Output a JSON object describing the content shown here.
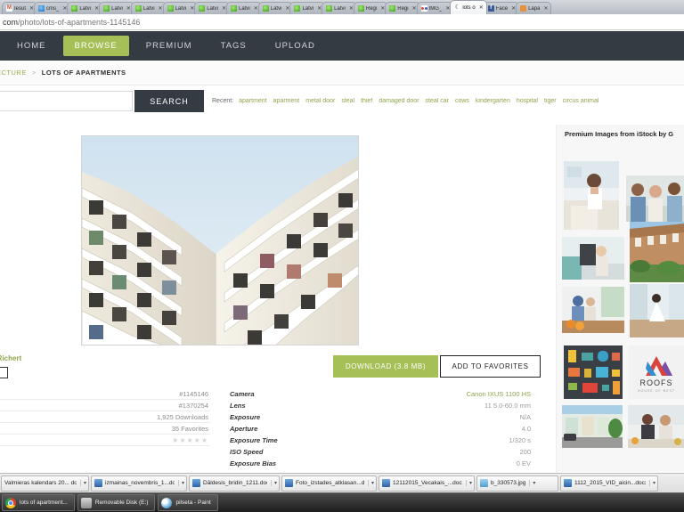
{
  "browser": {
    "tabs": [
      {
        "label": "Iesūt",
        "favicon": "gmail-icon",
        "active": false
      },
      {
        "label": "cms_",
        "favicon": "blue-globe-icon",
        "active": false
      },
      {
        "label": "Latvi",
        "favicon": "green-globe-icon",
        "active": false
      },
      {
        "label": "Latvi",
        "favicon": "green-globe-icon",
        "active": false
      },
      {
        "label": "Latvi",
        "favicon": "green-globe-icon",
        "active": false
      },
      {
        "label": "Latvi",
        "favicon": "green-globe-icon",
        "active": false
      },
      {
        "label": "Latvi",
        "favicon": "green-globe-icon",
        "active": false
      },
      {
        "label": "Latvi",
        "favicon": "green-globe-icon",
        "active": false
      },
      {
        "label": "Latvi",
        "favicon": "green-globe-icon",
        "active": false
      },
      {
        "label": "Latvi",
        "favicon": "green-globe-icon",
        "active": false
      },
      {
        "label": "Latvi",
        "favicon": "green-globe-icon",
        "active": false
      },
      {
        "label": "Reģi",
        "favicon": "green-globe-icon",
        "active": false
      },
      {
        "label": "Reģi",
        "favicon": "green-globe-icon",
        "active": false
      },
      {
        "label": "IMG_",
        "favicon": "dots-icon",
        "active": false
      },
      {
        "label": "lots o",
        "favicon": "moon-icon",
        "active": true
      },
      {
        "label": "Face",
        "favicon": "facebook-icon",
        "active": false
      },
      {
        "label": "Lapa",
        "favicon": "orange-icon",
        "active": false
      }
    ],
    "close_glyph": "✕",
    "url_domain": "com",
    "url_path": "/photo/lots-of-apartments-1145146"
  },
  "site": {
    "nav": [
      {
        "label": "HOME",
        "active": false
      },
      {
        "label": "BROWSE",
        "active": true
      },
      {
        "label": "PREMIUM",
        "active": false
      },
      {
        "label": "TAGS",
        "active": false
      },
      {
        "label": "UPLOAD",
        "active": false
      }
    ],
    "breadcrumb": {
      "previous": "ECTURE",
      "separator": ">",
      "current": "LOTS OF APARTMENTS"
    },
    "search": {
      "value": "",
      "placeholder": "",
      "button_label": "SEARCH",
      "recent_label": "Recent:",
      "recent_tags": [
        "apartment",
        "aparment",
        "metal door",
        "steal",
        "thief",
        "damaged door",
        "steal car",
        "cows",
        "kindergarten",
        "hospital",
        "tiger",
        "circus animal"
      ]
    },
    "photo": {
      "alt": "lots of apartments - modern apartment building facade with zigzag balconies"
    },
    "author": {
      "name": "a Richert"
    },
    "actions": {
      "download_label": "DOWNLOAD (3.8 MB)",
      "favorites_label": "ADD TO FAVORITES"
    },
    "stats": [
      {
        "value": "#1145146"
      },
      {
        "value": "#1370254"
      },
      {
        "value": "1,925 Downloads"
      },
      {
        "value": "35 Favorites"
      },
      {
        "value": "★★★★★"
      }
    ],
    "exif": [
      {
        "key": "Camera",
        "value": "Canon IXUS 1100 HS"
      },
      {
        "key": "Lens",
        "value": "11 5.0-60.0 mm"
      },
      {
        "key": "Exposure",
        "value": "N/A"
      },
      {
        "key": "Aperture",
        "value": "4.0"
      },
      {
        "key": "Exposure Time",
        "value": "1/320 s"
      },
      {
        "key": "ISO Speed",
        "value": "200"
      },
      {
        "key": "Exposure Bias",
        "value": "0 EV"
      }
    ],
    "sidebar": {
      "title": "Premium Images from iStock by G",
      "thumbnails": [
        {
          "name": "woman-in-kitchen"
        },
        {
          "name": "family-group-outdoor"
        },
        {
          "name": "woman-on-terrace"
        },
        {
          "name": "townhouses-street"
        },
        {
          "name": "family-breakfast"
        },
        {
          "name": "woman-on-deck"
        },
        {
          "name": "furniture-icons-set"
        },
        {
          "name": "roofs-logo",
          "caption": "ROOFS",
          "subcaption": "HOUSE OF BEST"
        },
        {
          "name": "colorful-street-houses"
        },
        {
          "name": "two-women-office"
        }
      ]
    },
    "colors": {
      "accent_green": "#a5c057",
      "nav_dark": "#343b43",
      "link_green": "#8fa44b"
    }
  },
  "windows": {
    "open_documents": [
      {
        "label": "Valmieras kalendars 20... doc",
        "icon": "word-icon",
        "arrow": "▾"
      },
      {
        "label": "izmainas_novembris_1...docx",
        "icon": "word-icon",
        "arrow": "▾"
      },
      {
        "label": "Dāldesis_bridin_1211.doc",
        "icon": "word-icon",
        "arrow": "▾"
      },
      {
        "label": "Foto_izstades_atklasan...doc",
        "icon": "word-icon",
        "arrow": "▾"
      },
      {
        "label": "12112015_Vecakais_...docx",
        "icon": "word-icon",
        "arrow": "▾"
      },
      {
        "label": "b_330573.jpg",
        "icon": "image-icon",
        "arrow": "▾"
      },
      {
        "label": "1112_2015_VID_aicin...docx",
        "icon": "word-icon",
        "arrow": "▾"
      }
    ],
    "taskbar": [
      {
        "label": "lots of apartment...",
        "icon": "chrome-icon"
      },
      {
        "label": "Removable Disk (E:)",
        "icon": "disk-icon"
      },
      {
        "label": "pilseta - Paint",
        "icon": "paint-icon"
      }
    ]
  }
}
